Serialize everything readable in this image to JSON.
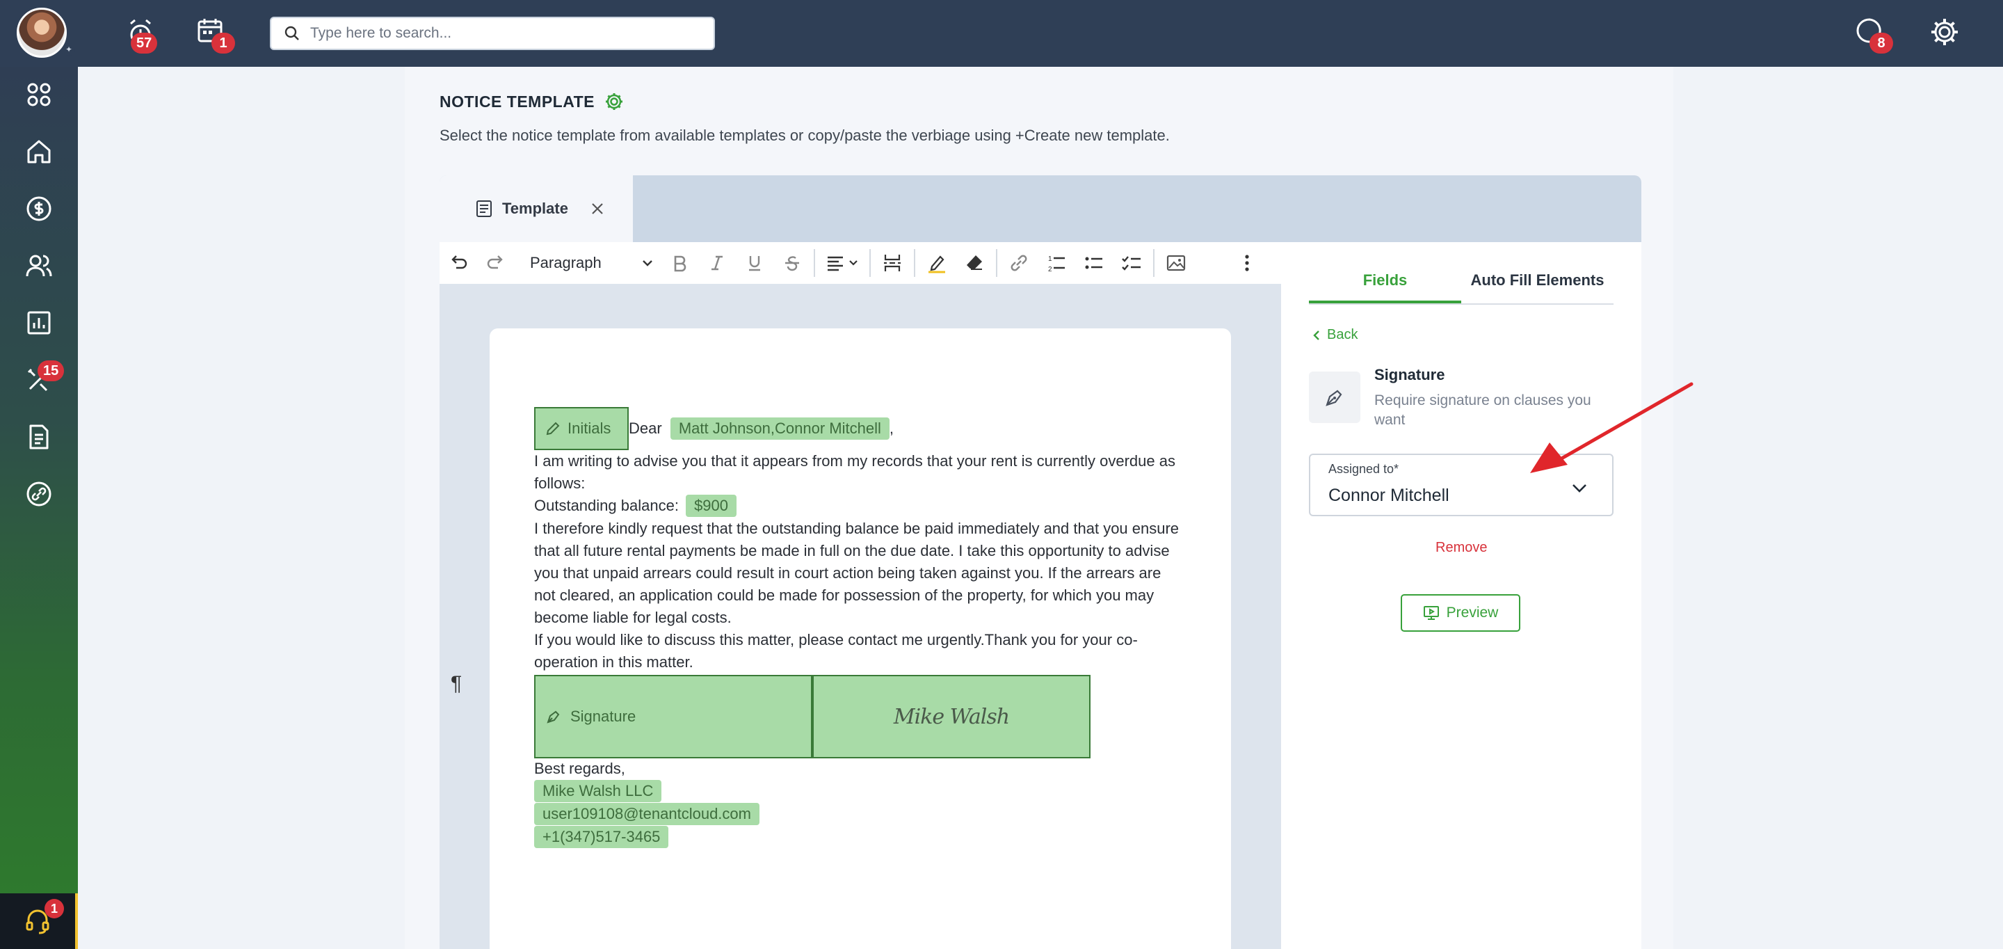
{
  "topbar": {
    "alerts_badge": "57",
    "calendar_badge": "1",
    "search_placeholder": "Type here to search...",
    "messages_badge": "8"
  },
  "sidebar": {
    "tools_badge": "15",
    "support_badge": "1"
  },
  "page": {
    "title": "NOTICE TEMPLATE",
    "description": "Select the notice template from available templates or copy/paste the verbiage using +Create new template."
  },
  "editor": {
    "tab_label": "Template",
    "paragraph_style": "Paragraph",
    "initials_label": "Initials",
    "greeting": "Dear",
    "recipients": "Matt Johnson,Connor Mitchell",
    "greeting_suffix": ",",
    "line1": "I am writing to advise you that it appears from my records that your rent is currently overdue as",
    "line2": "follows:",
    "balance_label": "Outstanding balance:",
    "balance_value": "$900",
    "line4": "I therefore kindly request that the outstanding balance be paid immediately and that you ensure",
    "line5": "that all future rental payments be made in full on the due date. I take this opportunity to advise",
    "line6": "you that unpaid arrears could result in court action being taken against you. If the arrears are",
    "line7": "not cleared, an application could be made for possession of the property, for which you may",
    "line8": "become liable for legal costs.",
    "line9": "If you would like to discuss this matter, please contact me urgently.Thank you for your co-",
    "line10": "operation in this matter.",
    "signature_label": "Signature",
    "signature_image_text": "Mike Walsh",
    "closing": "Best regards,",
    "company": "Mike Walsh LLC",
    "email": "user109108@tenantcloud.com",
    "phone": "+1(347)517-3465"
  },
  "panel": {
    "tab_fields": "Fields",
    "tab_autofill": "Auto Fill Elements",
    "back": "Back",
    "signature_title": "Signature",
    "signature_desc": "Require signature on clauses you want",
    "assigned_label": "Assigned to*",
    "assigned_value": "Connor Mitchell",
    "remove": "Remove",
    "preview": "Preview"
  },
  "colors": {
    "topbar": "#2f3f56",
    "accent_green": "#38a13b",
    "chip_green": "#a8dba7",
    "badge_red": "#d8323b",
    "annotation_arrow": "#e0262b"
  },
  "icons": [
    "avatar",
    "alarm-icon",
    "calendar-icon",
    "search-icon",
    "chat-icon",
    "gear-icon",
    "dashboard-icon",
    "home-icon",
    "dollar-icon",
    "users-icon",
    "chart-icon",
    "tools-icon",
    "document-icon",
    "link-icon",
    "headset-icon",
    "undo-icon",
    "redo-icon",
    "bold-icon",
    "italic-icon",
    "underline-icon",
    "strikethrough-icon",
    "align-icon",
    "page-break-icon",
    "highlight-icon",
    "eraser-icon",
    "hyperlink-icon",
    "numbered-list-icon",
    "bullet-list-icon",
    "checklist-icon",
    "image-icon",
    "more-icon",
    "pen-icon",
    "preview-icon"
  ]
}
